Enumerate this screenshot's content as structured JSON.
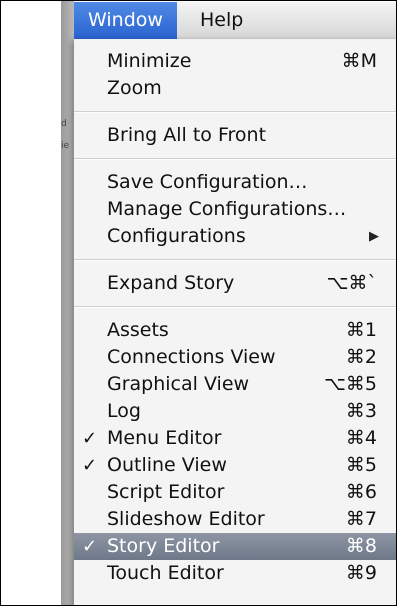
{
  "menubar": {
    "items": [
      {
        "label": "Window",
        "active": true
      },
      {
        "label": "Help",
        "active": false
      }
    ]
  },
  "menu": {
    "groups": [
      [
        {
          "label": "Minimize",
          "shortcut": "⌘M"
        },
        {
          "label": "Zoom",
          "shortcut": ""
        }
      ],
      [
        {
          "label": "Bring All to Front",
          "shortcut": ""
        }
      ],
      [
        {
          "label": "Save Configuration…",
          "shortcut": ""
        },
        {
          "label": "Manage Configurations…",
          "shortcut": ""
        },
        {
          "label": "Configurations",
          "shortcut": "",
          "submenu": true
        }
      ],
      [
        {
          "label": "Expand Story",
          "shortcut": "⌥⌘`"
        }
      ],
      [
        {
          "label": "Assets",
          "shortcut": "⌘1"
        },
        {
          "label": "Connections View",
          "shortcut": "⌘2"
        },
        {
          "label": "Graphical View",
          "shortcut": "⌥⌘5"
        },
        {
          "label": "Log",
          "shortcut": "⌘3"
        },
        {
          "label": "Menu Editor",
          "shortcut": "⌘4",
          "checked": true
        },
        {
          "label": "Outline View",
          "shortcut": "⌘5",
          "checked": true
        },
        {
          "label": "Script Editor",
          "shortcut": "⌘6"
        },
        {
          "label": "Slideshow Editor",
          "shortcut": "⌘7"
        },
        {
          "label": "Story Editor",
          "shortcut": "⌘8",
          "checked": true,
          "highlighted": true
        },
        {
          "label": "Touch Editor",
          "shortcut": "⌘9"
        }
      ]
    ],
    "check_glyph": "✓",
    "submenu_icon": "triangle-right-icon",
    "highlight_color": "#7b8494"
  },
  "background_fragments": [
    "d",
    "ie"
  ]
}
